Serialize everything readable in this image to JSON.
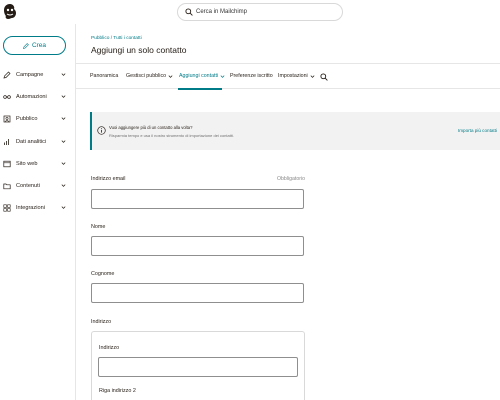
{
  "app": {
    "logo_icon": "mailchimp-logo",
    "search_placeholder": "Cerca in Mailchimp"
  },
  "sidebar": {
    "create_label": "Crea",
    "items": [
      {
        "label": "Campagne",
        "icon": "pencil-icon"
      },
      {
        "label": "Automazioni",
        "icon": "automation-icon"
      },
      {
        "label": "Pubblico",
        "icon": "audience-icon"
      },
      {
        "label": "Dati analitici",
        "icon": "chart-icon"
      },
      {
        "label": "Sito web",
        "icon": "website-icon"
      },
      {
        "label": "Contenuti",
        "icon": "folder-icon"
      },
      {
        "label": "Integrazioni",
        "icon": "grid-icon"
      }
    ]
  },
  "header": {
    "breadcrumb": "Pubblico / Tutti i contatti",
    "title": "Aggiungi un solo contatto"
  },
  "tabs": [
    {
      "label": "Panoramica",
      "dropdown": false
    },
    {
      "label": "Gestisci pubblico",
      "dropdown": true
    },
    {
      "label": "Aggiungi contatti",
      "dropdown": true,
      "active": true
    },
    {
      "label": "Preferenze iscritto",
      "dropdown": false
    },
    {
      "label": "Impostazioni",
      "dropdown": true
    }
  ],
  "banner": {
    "title": "Vuoi aggiungere più di un contatto alla volta?",
    "text": "Risparmia tempo e usa il nostro strumento di importazione dei contatti.",
    "link": "Importa più contatti"
  },
  "form": {
    "email_label": "Indirizzo email",
    "email_required": "Obbligatorio",
    "email_value": "",
    "first_name_label": "Nome",
    "first_name_value": "",
    "last_name_label": "Cognome",
    "last_name_value": "",
    "address_section_label": "Indirizzo",
    "address_label": "Indirizzo",
    "address_value": "",
    "address_line2_label": "Riga indirizzo 2"
  },
  "colors": {
    "accent": "#007c89",
    "text": "#241c15",
    "border": "#8f8f8f",
    "banner_bg": "#f2f2f2"
  }
}
